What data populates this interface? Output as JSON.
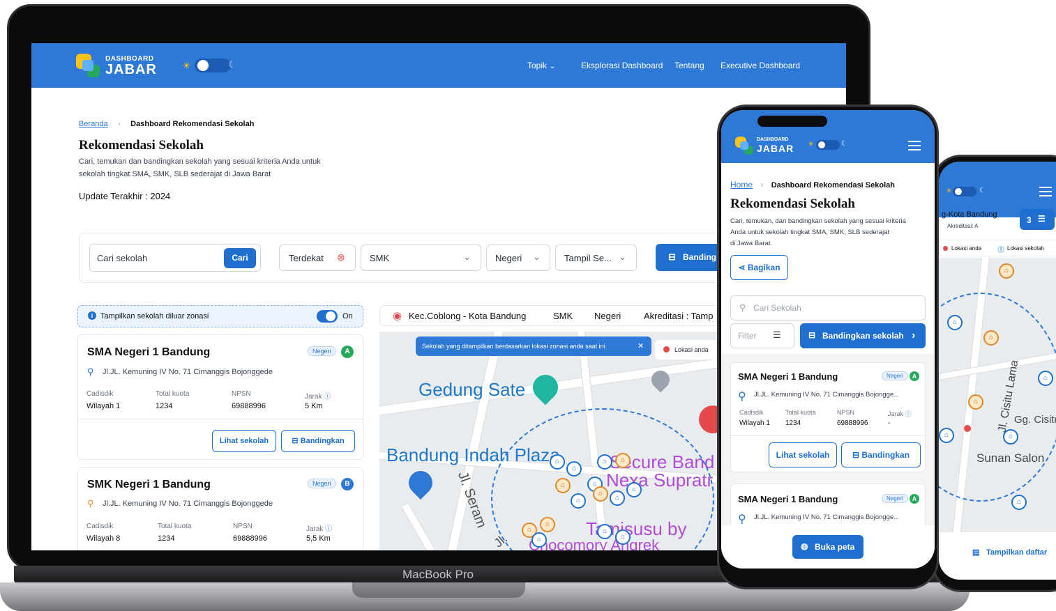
{
  "desktop": {
    "logo": {
      "small": "DASHBOARD",
      "big": "JABAR"
    },
    "nav": [
      "Topik",
      "Eksplorasi Dashboard",
      "Tentang",
      "Executive Dashboard"
    ],
    "breadcrumb": {
      "home": "Beranda",
      "current": "Dashboard Rekomendasi Sekolah"
    },
    "title": "Rekomendasi Sekolah",
    "description_1": "Cari, temukan dan bandingkan   sekolah yang sesuai kriteria Anda untuk",
    "description_2": "sekolah tingkat SMA, SMK, SLB sederajat di Jawa Barat",
    "update": "Update Terakhir : 2024",
    "search": {
      "placeholder": "Cari sekolah",
      "button": "Cari"
    },
    "filters": {
      "sort": "Terdekat",
      "level": "SMK",
      "status": "Negeri",
      "show": "Tampil Se...",
      "compare": "Banding"
    },
    "zonasi": {
      "label": "Tampilkan sekolah diluar zonasi",
      "toggle": "On"
    },
    "map_bar": [
      "Kec.Coblong - Kota Bandung",
      "SMK",
      "Negeri",
      "Akreditasi : Tamp"
    ],
    "map_banner": "Sekolah yang ditampilkan berdasarkan lokasi zonasi anda saat ini.",
    "map_location": "Lokasi anda",
    "map_labels": [
      "Gedung Sate",
      "Bandung Indah Plaza",
      "Secure Band",
      "Nexa Supratr",
      "Jl. Seram",
      "Jl.",
      "Tamisusu by",
      "Chocomory Angrek"
    ],
    "cards": [
      {
        "name": "SMA Negeri 1 Bandung",
        "badge": "Negeri",
        "acc": "A",
        "address": "Jl.JL. Kemuning IV No. 71 Cimanggis Bojonggede",
        "labels": [
          "Cadisdik",
          "Total kuota",
          "NPSN",
          "Jarak"
        ],
        "values": [
          "Wilayah 1",
          "1234",
          "69888996",
          "5 Km"
        ]
      },
      {
        "name": "SMK Negeri 1 Bandung",
        "badge": "Negeri",
        "acc": "B",
        "address": "Jl.JL. Kemuning IV No. 71 Cimanggis Bojonggede",
        "labels": [
          "Cadisdik",
          "Total kuota",
          "NPSN",
          "Jarak"
        ],
        "values": [
          "Wilayah 8",
          "1234",
          "69888996",
          "5,5 Km"
        ]
      }
    ],
    "card_buttons": {
      "view": "Lihat sekolah",
      "compare": "Bandingkan"
    },
    "device_label": "MacBook Pro"
  },
  "phone1": {
    "logo": {
      "small": "DASHBOARD",
      "big": "JABAR"
    },
    "breadcrumb": {
      "home": "Home",
      "current": "Dashboard Rekomendasi Sekolah"
    },
    "title": "Rekomendasi Sekolah",
    "description_1": "Cari, temukan, dan bandingkan sekolah yang sesuai kriteria",
    "description_2": "Anda untuk sekolah tingkat SMA, SMK, SLB sederajat",
    "description_3": "di Jawa Barat.",
    "share": "Bagikan",
    "search_placeholder": "Cari Sekolah",
    "filter": "Filter",
    "compare": "Bandingkan sekolah",
    "cards": [
      {
        "name": "SMA Negeri 1 Bandung",
        "badge": "Negeri",
        "acc": "A",
        "address": "Jl.JL. Kemuning IV No. 71 Cimanggis Bojongge...",
        "labels": [
          "Cadisdik",
          "Total kuota",
          "NPSN",
          "Jarak"
        ],
        "values": [
          "Wilayah 1",
          "1234",
          "69888996",
          "-"
        ]
      },
      {
        "name": "SMA Negeri 1 Bandung",
        "badge": "Negeri",
        "acc": "A",
        "address": "Jl.JL. Kemuning IV No. 71 Cimanggis Bojongge..."
      }
    ],
    "card_buttons": {
      "view": "Lihat sekolah",
      "compare": "Bandingkan"
    },
    "open_map": "Buka peta"
  },
  "phone2": {
    "header": "g-Kota Bandung",
    "sub": "Akreditasi: A",
    "count": "3",
    "legend": [
      "Lokasi anda",
      "Lokasi sekolah"
    ],
    "map_labels": [
      "Jl. Cisitu Lama",
      "Gg. Cisitu",
      "Sunan Salon"
    ],
    "list_button": "Tampilkan daftar"
  },
  "colors": {
    "primary": "#2e78d6",
    "accent_green": "#26a95c",
    "accent_yellow": "#f6c21b",
    "accent_blue_badge": "#2e78d6",
    "danger": "#e5484d"
  }
}
